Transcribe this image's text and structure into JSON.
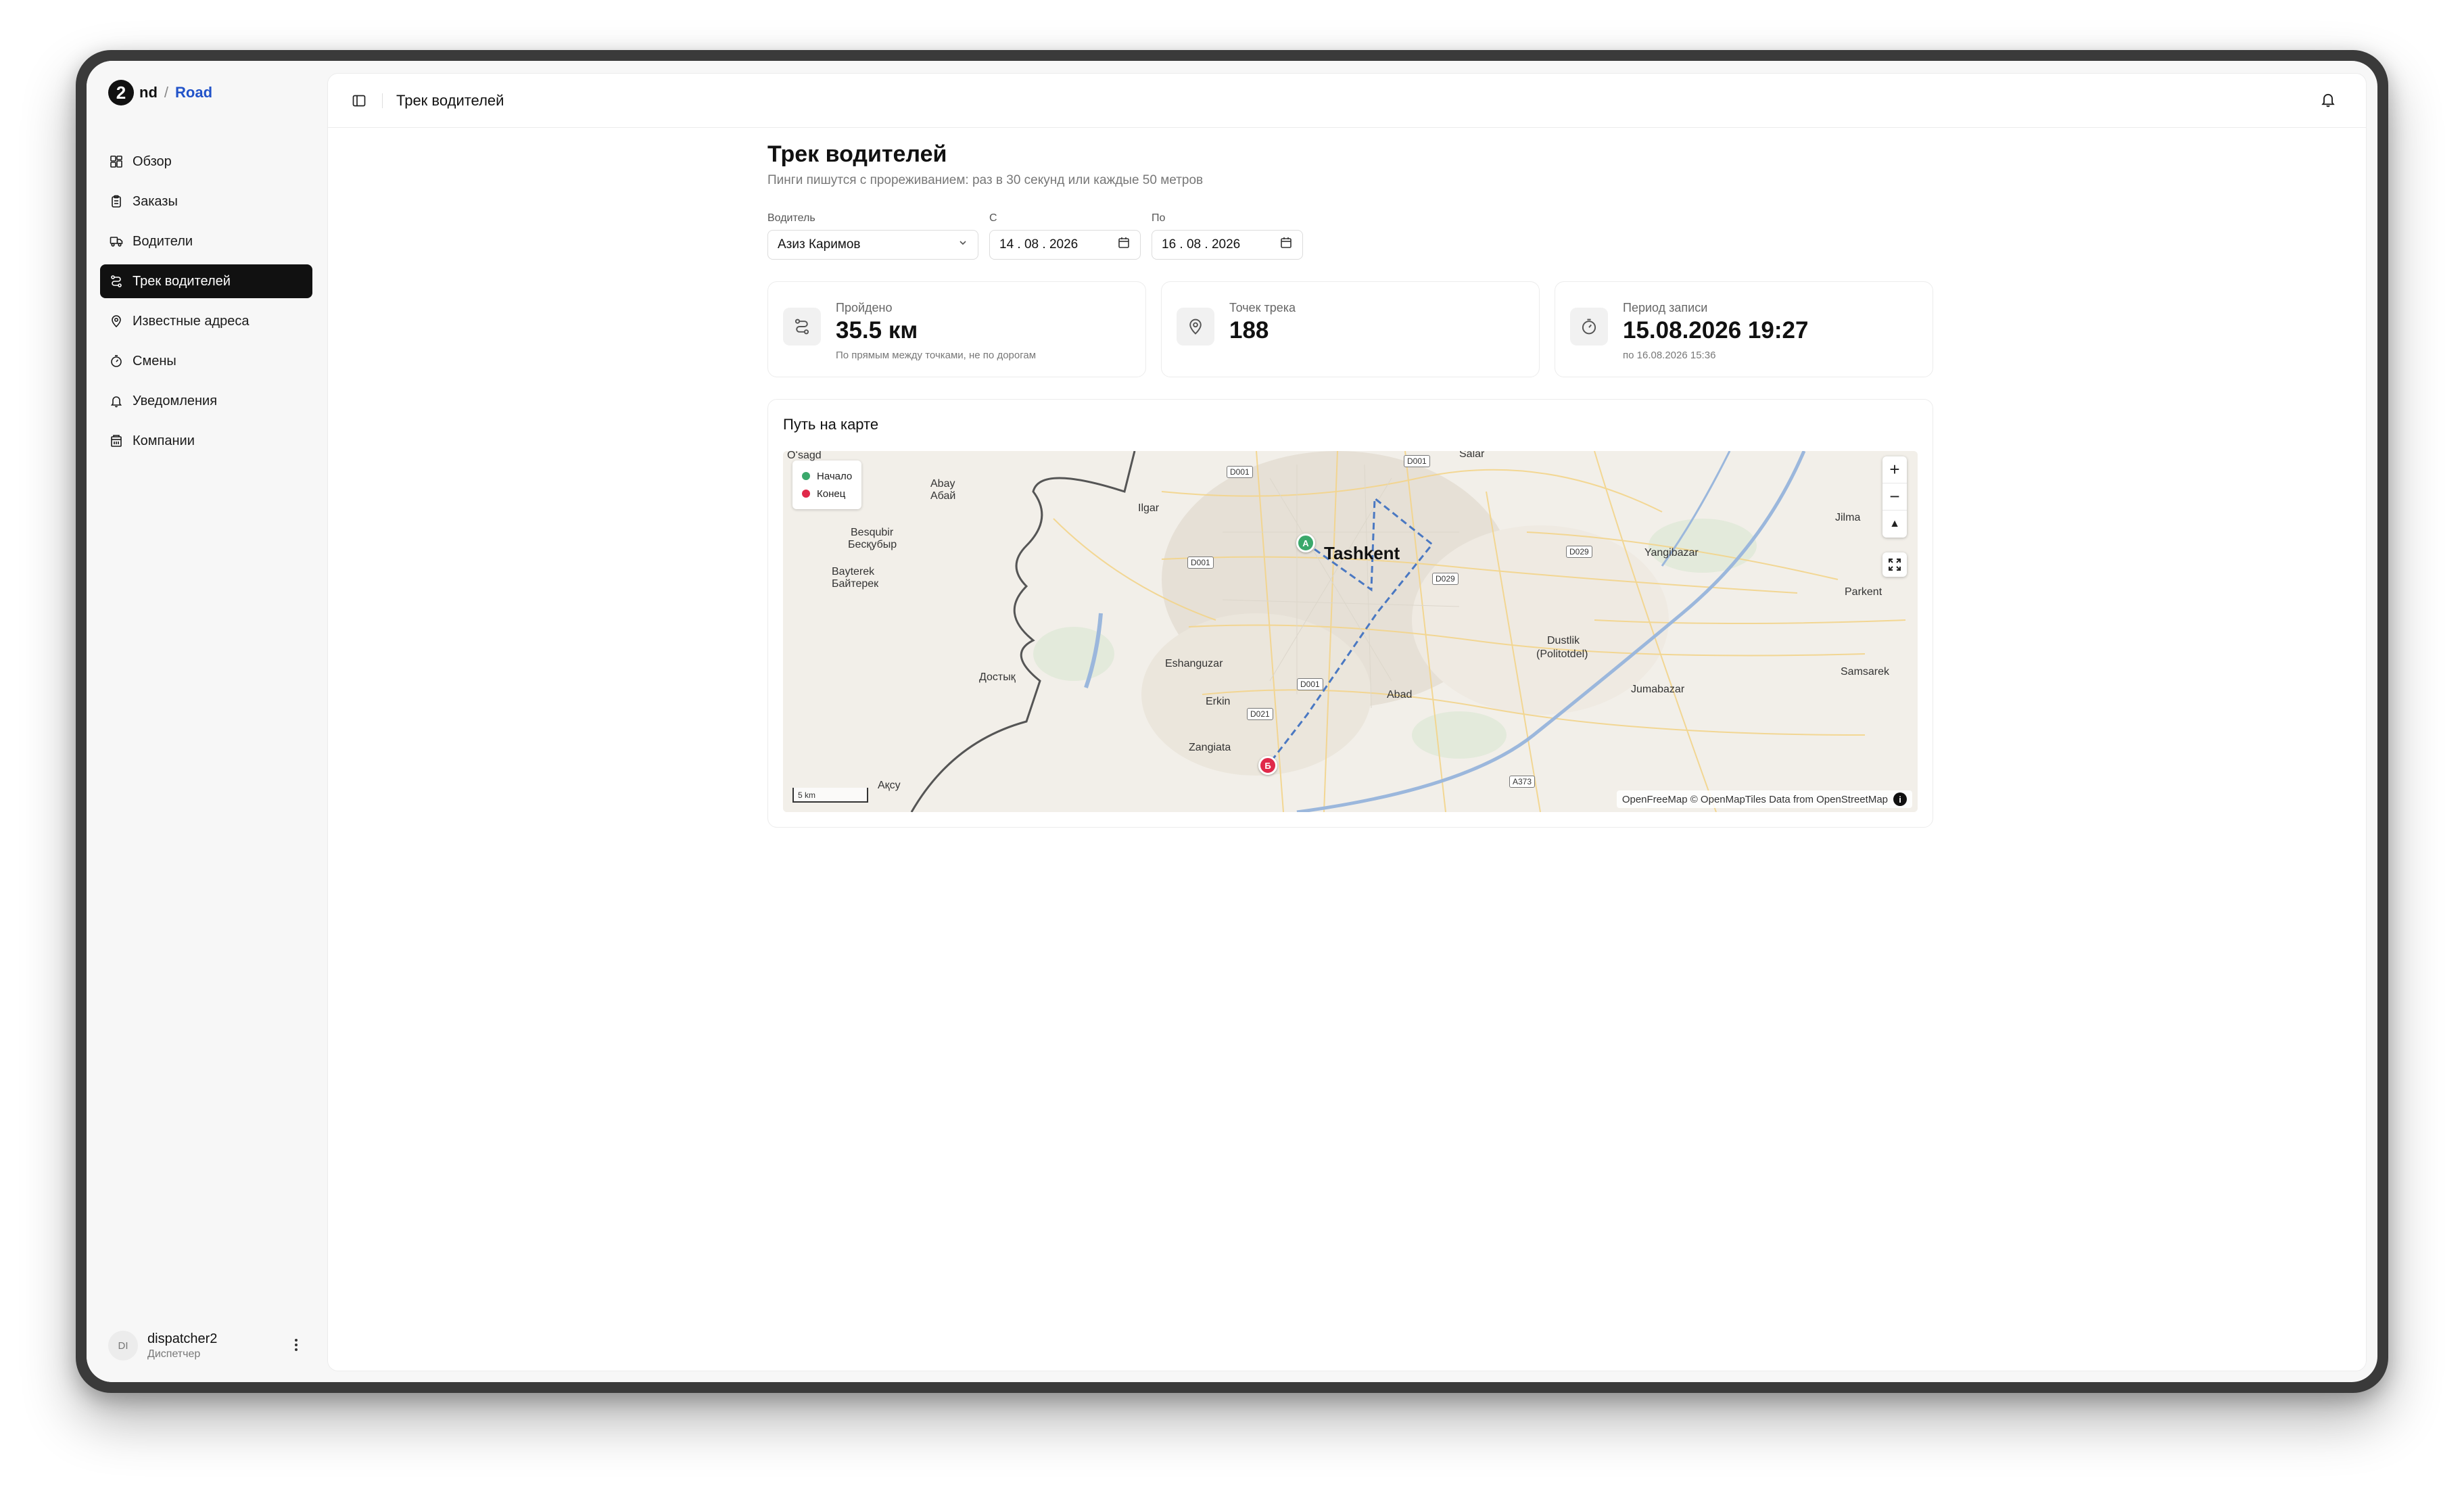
{
  "app": {
    "logo_mark": "2",
    "logo_nd": "nd",
    "logo_slash": "/",
    "logo_road": "Road"
  },
  "sidebar": {
    "items": [
      {
        "label": "Обзор",
        "icon": "dashboard-icon"
      },
      {
        "label": "Заказы",
        "icon": "clipboard-icon"
      },
      {
        "label": "Водители",
        "icon": "truck-icon"
      },
      {
        "label": "Трек водителей",
        "icon": "route-icon",
        "active": true
      },
      {
        "label": "Известные адреса",
        "icon": "map-pin-icon"
      },
      {
        "label": "Смены",
        "icon": "timer-icon"
      },
      {
        "label": "Уведомления",
        "icon": "bell-icon"
      },
      {
        "label": "Компании",
        "icon": "building-icon"
      }
    ],
    "user": {
      "initials": "DI",
      "name": "dispatcher2",
      "role": "Диспетчер"
    }
  },
  "topbar": {
    "breadcrumb": "Трек водителей"
  },
  "page": {
    "title": "Трек водителей",
    "subtitle": "Пинги пишутся с прореживанием: раз в 30 секунд или каждые 50 метров"
  },
  "filters": {
    "driver_label": "Водитель",
    "driver_value": "Азиз Каримов",
    "from_label": "С",
    "from_value": "14 . 08 . 2026",
    "to_label": "По",
    "to_value": "16 . 08 . 2026"
  },
  "stats": {
    "distance": {
      "label": "Пройдено",
      "value": "35.5 км",
      "note": "По прямым между точками, не по дорогам"
    },
    "points": {
      "label": "Точек трека",
      "value": "188"
    },
    "period": {
      "label": "Период записи",
      "value": "15.08.2026 19:27",
      "note": "по 16.08.2026 15:36"
    }
  },
  "map": {
    "title": "Путь на карте",
    "legend_start": "Начало",
    "legend_end": "Конец",
    "marker_start": "А",
    "marker_end": "Б",
    "zoom_in": "+",
    "zoom_out": "−",
    "compass": "▲",
    "scale": "5 km",
    "attribution": "OpenFreeMap © OpenMapTiles Data from OpenStreetMap",
    "attribution_icon": "i",
    "places": {
      "tashkent": "Tashkent",
      "osagd": "Oʻsagd",
      "salar": "Salar",
      "abay": "Abay",
      "abay_cyr": "Абай",
      "ilgar": "Ilgar",
      "besqubir": "Besqubir",
      "besqubir_cyr": "Бесқубыр",
      "bayterek": "Bayterek",
      "bayterek_cyr": "Байтерек",
      "dostyk": "Достық",
      "eshanguzar": "Eshanguzar",
      "erkin": "Erkin",
      "zangiata": "Zangiata",
      "aksu": "Ақсу",
      "abad": "Abad",
      "yangibazar": "Yangibazar",
      "jilma": "Jilma",
      "parkent": "Parkent",
      "dustlik": "Dustlik",
      "politotdel": "(Politotdel)",
      "jumabazar": "Jumabazar",
      "samsarek": "Samsarek"
    },
    "roads": [
      "D001",
      "D001",
      "D001",
      "D029",
      "D029",
      "D001",
      "D021",
      "A373"
    ],
    "colors": {
      "start": "#3aa86b",
      "end": "#e0294a",
      "route": "#4a78c2"
    }
  }
}
